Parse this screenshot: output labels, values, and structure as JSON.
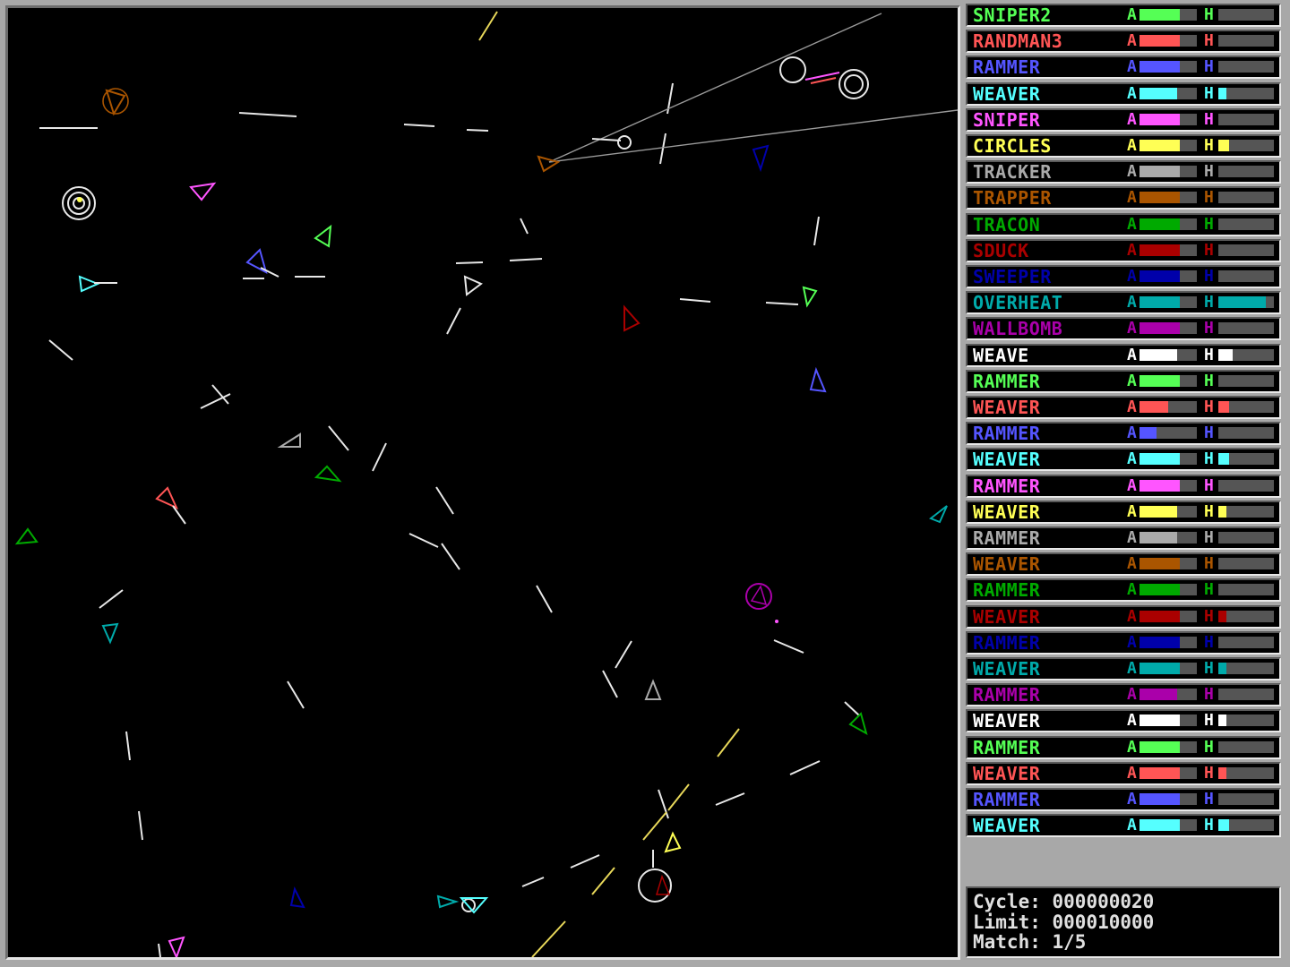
{
  "robots": [
    {
      "name": "SNIPER2",
      "color": "#55ff55",
      "armor": 0.7,
      "heat": 0.0,
      "label_a": "A",
      "label_h": "H"
    },
    {
      "name": "RANDMAN3",
      "color": "#ff5555",
      "armor": 0.7,
      "heat": 0.0,
      "label_a": "A",
      "label_h": "H"
    },
    {
      "name": "RAMMER",
      "color": "#5555ff",
      "armor": 0.7,
      "heat": 0.0,
      "label_a": "A",
      "label_h": "H"
    },
    {
      "name": "WEAVER",
      "color": "#55ffff",
      "armor": 0.65,
      "heat": 0.15,
      "label_a": "A",
      "label_h": "H"
    },
    {
      "name": "SNIPER",
      "color": "#ff55ff",
      "armor": 0.7,
      "heat": 0.0,
      "label_a": "A",
      "label_h": "H"
    },
    {
      "name": "CIRCLES",
      "color": "#ffff55",
      "armor": 0.7,
      "heat": 0.2,
      "label_a": "A",
      "label_h": "H"
    },
    {
      "name": "TRACKER",
      "color": "#aaaaaa",
      "armor": 0.7,
      "heat": 0.0,
      "label_a": "A",
      "label_h": "H"
    },
    {
      "name": "TRAPPER",
      "color": "#aa5500",
      "armor": 0.7,
      "heat": 0.0,
      "label_a": "A",
      "label_h": "H"
    },
    {
      "name": "TRACON",
      "color": "#00aa00",
      "armor": 0.7,
      "heat": 0.0,
      "label_a": "A",
      "label_h": "H"
    },
    {
      "name": "SDUCK",
      "color": "#aa0000",
      "armor": 0.7,
      "heat": 0.0,
      "label_a": "A",
      "label_h": "H"
    },
    {
      "name": "SWEEPER",
      "color": "#0000aa",
      "armor": 0.7,
      "heat": 0.0,
      "label_a": "A",
      "label_h": "H"
    },
    {
      "name": "OVERHEAT",
      "color": "#00aaaa",
      "armor": 0.7,
      "heat": 0.85,
      "label_a": "A",
      "label_h": "H"
    },
    {
      "name": "WALLBOMB",
      "color": "#aa00aa",
      "armor": 0.7,
      "heat": 0.0,
      "label_a": "A",
      "label_h": "H"
    },
    {
      "name": "WEAVE",
      "color": "#ffffff",
      "armor": 0.65,
      "heat": 0.25,
      "label_a": "A",
      "label_h": "H"
    },
    {
      "name": "RAMMER",
      "color": "#55ff55",
      "armor": 0.7,
      "heat": 0.0,
      "label_a": "A",
      "label_h": "H"
    },
    {
      "name": "WEAVER",
      "color": "#ff5555",
      "armor": 0.5,
      "heat": 0.2,
      "label_a": "A",
      "label_h": "H"
    },
    {
      "name": "RAMMER",
      "color": "#5555ff",
      "armor": 0.3,
      "heat": 0.0,
      "label_a": "A",
      "label_h": "H"
    },
    {
      "name": "WEAVER",
      "color": "#55ffff",
      "armor": 0.7,
      "heat": 0.2,
      "label_a": "A",
      "label_h": "H"
    },
    {
      "name": "RAMMER",
      "color": "#ff55ff",
      "armor": 0.7,
      "heat": 0.0,
      "label_a": "A",
      "label_h": "H"
    },
    {
      "name": "WEAVER",
      "color": "#ffff55",
      "armor": 0.65,
      "heat": 0.15,
      "label_a": "A",
      "label_h": "H"
    },
    {
      "name": "RAMMER",
      "color": "#aaaaaa",
      "armor": 0.65,
      "heat": 0.0,
      "label_a": "A",
      "label_h": "H"
    },
    {
      "name": "WEAVER",
      "color": "#aa5500",
      "armor": 0.7,
      "heat": 0.0,
      "label_a": "A",
      "label_h": "H"
    },
    {
      "name": "RAMMER",
      "color": "#00aa00",
      "armor": 0.7,
      "heat": 0.0,
      "label_a": "A",
      "label_h": "H"
    },
    {
      "name": "WEAVER",
      "color": "#aa0000",
      "armor": 0.7,
      "heat": 0.15,
      "label_a": "A",
      "label_h": "H"
    },
    {
      "name": "RAMMER",
      "color": "#0000aa",
      "armor": 0.7,
      "heat": 0.0,
      "label_a": "A",
      "label_h": "H"
    },
    {
      "name": "WEAVER",
      "color": "#00aaaa",
      "armor": 0.7,
      "heat": 0.15,
      "label_a": "A",
      "label_h": "H"
    },
    {
      "name": "RAMMER",
      "color": "#aa00aa",
      "armor": 0.65,
      "heat": 0.0,
      "label_a": "A",
      "label_h": "H"
    },
    {
      "name": "WEAVER",
      "color": "#ffffff",
      "armor": 0.7,
      "heat": 0.15,
      "label_a": "A",
      "label_h": "H"
    },
    {
      "name": "RAMMER",
      "color": "#55ff55",
      "armor": 0.7,
      "heat": 0.0,
      "label_a": "A",
      "label_h": "H"
    },
    {
      "name": "WEAVER",
      "color": "#ff5555",
      "armor": 0.7,
      "heat": 0.15,
      "label_a": "A",
      "label_h": "H"
    },
    {
      "name": "RAMMER",
      "color": "#5555ff",
      "armor": 0.7,
      "heat": 0.0,
      "label_a": "A",
      "label_h": "H"
    },
    {
      "name": "WEAVER",
      "color": "#55ffff",
      "armor": 0.7,
      "heat": 0.2,
      "label_a": "A",
      "label_h": "H"
    }
  ],
  "status": {
    "cycle_label": "Cycle:",
    "cycle_value": "000000020",
    "limit_label": "Limit:",
    "limit_value": "000010000",
    "match_label": "Match:",
    "match_value": "1/5"
  }
}
